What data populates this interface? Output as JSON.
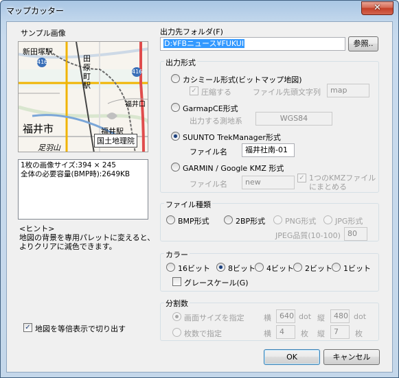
{
  "window": {
    "title": "マップカッター",
    "close": "✕"
  },
  "left": {
    "sample_label": "サンプル画像",
    "map_labels": {
      "shindenhoshi": "新田塚駅",
      "tahara": "田原町駅",
      "route416_a": "416",
      "route416_b": "416",
      "fukui_city": "福井市",
      "fukui_station": "福井駅",
      "fukui_ic": "福井口",
      "ashiwayama": "足羽山",
      "gsi": "国土地理院"
    },
    "info_lines": [
      "1枚の画像サイズ:394 × 245",
      "全体の必要容量(BMP時):2649KB"
    ],
    "hint_title": "<ヒント>",
    "hint_lines": [
      "地図の背景を専用パレットに変えると、",
      "よりクリアに減色できます。"
    ],
    "equal_scale_label": "地図を等倍表示で切り出す",
    "equal_scale_checked": true
  },
  "output": {
    "folder_label": "出力先フォルダ(F)",
    "folder_value": "D:¥FBニュース¥FUKUI",
    "browse_label": "参照..",
    "format_group": "出力形式",
    "kashmir_label": "カシミール形式(ビットマップ地図)",
    "compress_label": "圧縮する",
    "prefix_label": "ファイル先頭文字列",
    "prefix_value": "map",
    "garmap_label": "GarmapCE形式",
    "datum_label": "出力する測地系",
    "datum_value": "WGS84",
    "suunto_label": "SUUNTO TrekManager形式",
    "suunto_file_label": "ファイル名",
    "suunto_file_value": "福井社南-01",
    "garmin_label": "GARMIN / Google KMZ 形式",
    "garmin_file_label": "ファイル名",
    "garmin_file_value": "new",
    "kmz_merge_label_1": "1つのKMZファイル",
    "kmz_merge_label_2": "にまとめる",
    "selected_format": "suunto"
  },
  "filetype": {
    "group": "ファイル種類",
    "bmp": "BMP形式",
    "twobp": "2BP形式",
    "png": "PNG形式",
    "jpg": "JPG形式",
    "jpeg_quality_label": "JPEG品質(10-100)",
    "jpeg_quality_value": "80",
    "selected": "none"
  },
  "color": {
    "group": "カラー",
    "b16": "16ビット",
    "b8": "8ビット",
    "b4": "4ビット",
    "b2": "2ビット",
    "b1": "1ビット",
    "selected": "8",
    "grayscale_label": "グレースケール(G)"
  },
  "split": {
    "group": "分割数",
    "screen_size_label": "画面サイズを指定",
    "count_label": "枚数で指定",
    "width_label": "横",
    "height_label": "縦",
    "width_value": "640",
    "height_value": "480",
    "dot_unit": "dot",
    "count_w": "4",
    "count_h": "7",
    "sheet_unit": "枚"
  },
  "buttons": {
    "ok": "OK",
    "cancel": "キャンセル"
  },
  "colors": {
    "title_gradient_top": "#a9c6e4",
    "client_bg": "#f0f0f0",
    "selection": "#3399ff",
    "close_red": "#c43f27"
  }
}
